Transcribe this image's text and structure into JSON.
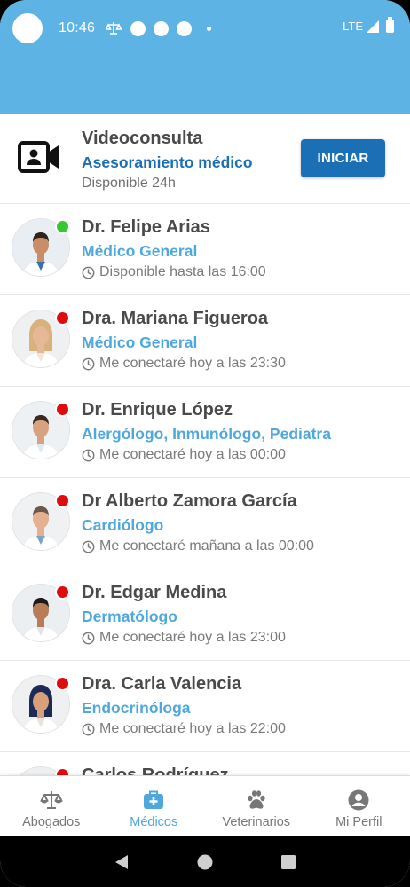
{
  "status_bar": {
    "time": "10:46",
    "network": "LTE"
  },
  "video": {
    "title": "Videoconsulta",
    "subtitle": "Asesoramiento médico",
    "availability": "Disponible 24h",
    "button_label": "INICIAR"
  },
  "doctors": [
    {
      "name": "Dr. Felipe Arias",
      "specialty": "Médico General",
      "status_text": "Disponible hasta las 16:00",
      "online": true
    },
    {
      "name": "Dra. Mariana Figueroa",
      "specialty": "Médico General",
      "status_text": "Me conectaré hoy a las 23:30",
      "online": false
    },
    {
      "name": "Dr. Enrique López",
      "specialty": "Alergólogo, Inmunólogo, Pediatra",
      "status_text": "Me conectaré hoy a las 00:00",
      "online": false
    },
    {
      "name": "Dr Alberto Zamora García",
      "specialty": "Cardiólogo",
      "status_text": "Me conectaré mañana a las 00:00",
      "online": false
    },
    {
      "name": "Dr. Edgar Medina",
      "specialty": "Dermatólogo",
      "status_text": "Me conectaré hoy a las 23:00",
      "online": false
    },
    {
      "name": "Dra. Carla Valencia",
      "specialty": "Endocrinóloga",
      "status_text": "Me conectaré hoy a las 22:00",
      "online": false
    },
    {
      "name": "Carlos Rodríguez",
      "specialty": "",
      "status_text": "",
      "online": false
    }
  ],
  "nav": {
    "items": [
      {
        "label": "Abogados",
        "icon": "scale-icon"
      },
      {
        "label": "Médicos",
        "icon": "medical-kit-icon"
      },
      {
        "label": "Veterinarios",
        "icon": "paw-icon"
      },
      {
        "label": "Mi Perfil",
        "icon": "profile-icon"
      }
    ],
    "active_index": 1
  },
  "colors": {
    "header": "#5db3e3",
    "primary_blue": "#1b6fb4",
    "specialty_blue": "#4fa8dc",
    "online": "#35c930",
    "offline": "#e00b0b"
  }
}
